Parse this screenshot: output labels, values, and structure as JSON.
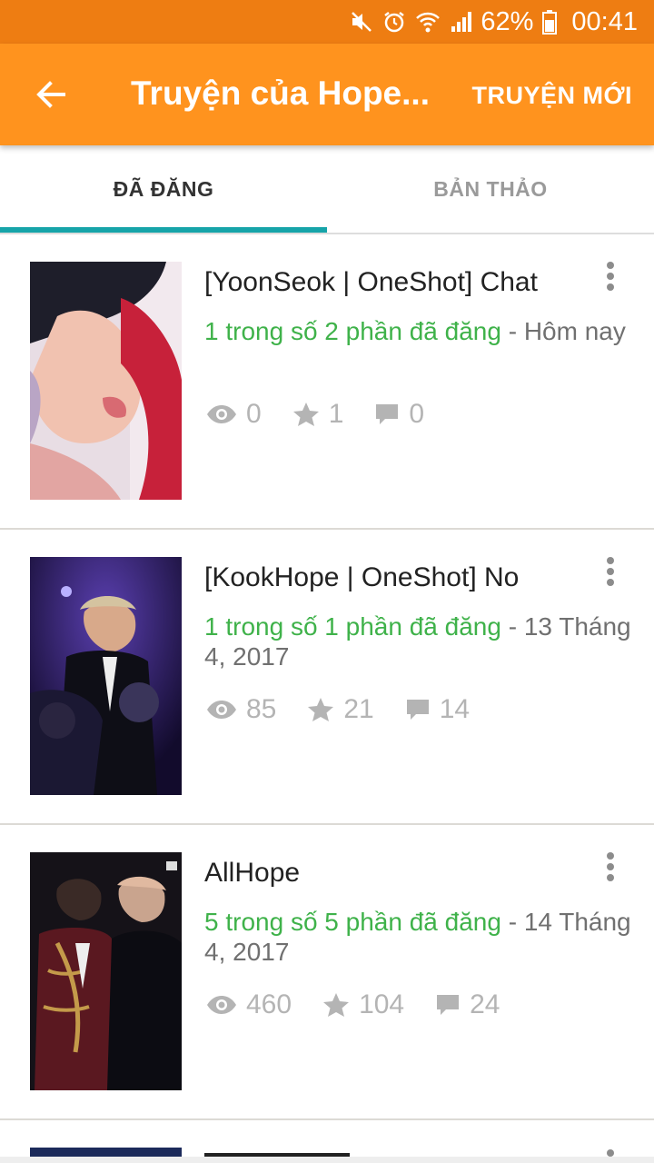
{
  "status_bar": {
    "battery": "62%",
    "time": "00:41",
    "icons": [
      "mute-icon",
      "alarm-icon",
      "wifi-icon",
      "signal-icon",
      "battery-icon"
    ]
  },
  "app_bar": {
    "title": "Truyện của Hope...",
    "action_label": "TRUYỆN MỚI",
    "color": "#ff931e"
  },
  "tabs": [
    {
      "label": "ĐÃ ĐĂNG",
      "active": true
    },
    {
      "label": "BẢN THẢO",
      "active": false
    }
  ],
  "accent_color": "#16a4a9",
  "stories": [
    {
      "title": "[YoonSeok | OneShot] Chat",
      "parts_text": "1 trong số 2 phần đã đăng",
      "date_text": " - Hôm nay",
      "views": "0",
      "votes": "1",
      "comments": "0"
    },
    {
      "title": "[KookHope | OneShot] No",
      "parts_text": "1 trong số 1 phần đã đăng",
      "date_text": " - 13 Tháng 4, 2017",
      "views": "85",
      "votes": "21",
      "comments": "14"
    },
    {
      "title": "AllHope",
      "parts_text": "5 trong số 5 phần đã đăng",
      "date_text": " - 14 Tháng 4, 2017",
      "views": "460",
      "votes": "104",
      "comments": "24"
    }
  ]
}
